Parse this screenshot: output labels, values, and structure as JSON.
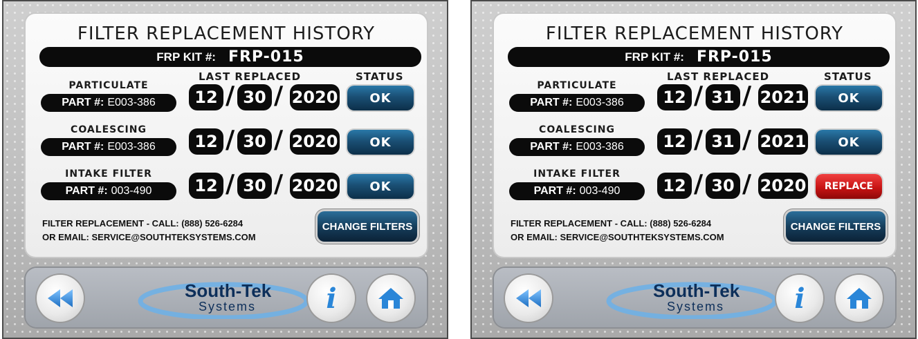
{
  "screens": [
    {
      "title": "FILTER REPLACEMENT HISTORY",
      "kit_label": "FRP KIT #:",
      "kit_value": "FRP-015",
      "col_last_replaced": "LAST REPLACED",
      "col_status": "STATUS",
      "filters": [
        {
          "name": "PARTICULATE",
          "part_label": "PART #:",
          "part_value": "E003-386",
          "month": "12",
          "day": "30",
          "year": "2020",
          "status": "OK"
        },
        {
          "name": "COALESCING",
          "part_label": "PART #:",
          "part_value": "E003-386",
          "month": "12",
          "day": "30",
          "year": "2020",
          "status": "OK"
        },
        {
          "name": "INTAKE FILTER",
          "part_label": "PART #:",
          "part_value": "003-490",
          "month": "12",
          "day": "30",
          "year": "2020",
          "status": "OK"
        }
      ],
      "contact_line1": "FILTER REPLACEMENT - CALL: (888) 526-6284",
      "contact_line2": "OR EMAIL: SERVICE@SOUTHTEKSYSTEMS.COM",
      "change_filters_label": "CHANGE FILTERS",
      "logo_main": "South-Tek",
      "logo_sub": "Systems",
      "info_icon_glyph": "i"
    },
    {
      "title": "FILTER REPLACEMENT HISTORY",
      "kit_label": "FRP KIT #:",
      "kit_value": "FRP-015",
      "col_last_replaced": "LAST REPLACED",
      "col_status": "STATUS",
      "filters": [
        {
          "name": "PARTICULATE",
          "part_label": "PART #:",
          "part_value": "E003-386",
          "month": "12",
          "day": "31",
          "year": "2021",
          "status": "OK"
        },
        {
          "name": "COALESCING",
          "part_label": "PART #:",
          "part_value": "E003-386",
          "month": "12",
          "day": "31",
          "year": "2021",
          "status": "OK"
        },
        {
          "name": "INTAKE FILTER",
          "part_label": "PART #:",
          "part_value": "003-490",
          "month": "12",
          "day": "30",
          "year": "2020",
          "status": "REPLACE"
        }
      ],
      "contact_line1": "FILTER REPLACEMENT - CALL: (888) 526-6284",
      "contact_line2": "OR EMAIL: SERVICE@SOUTHTEKSYSTEMS.COM",
      "change_filters_label": "CHANGE FILTERS",
      "logo_main": "South-Tek",
      "logo_sub": "Systems",
      "info_icon_glyph": "i"
    }
  ],
  "colors": {
    "ok_button": "#1a4f74",
    "replace_button": "#c81414",
    "brand_blue": "#0d2f5a",
    "pill_black": "#0b0b0b"
  },
  "icons": {
    "back": "rewind-icon",
    "info": "info-icon",
    "home": "home-icon"
  }
}
